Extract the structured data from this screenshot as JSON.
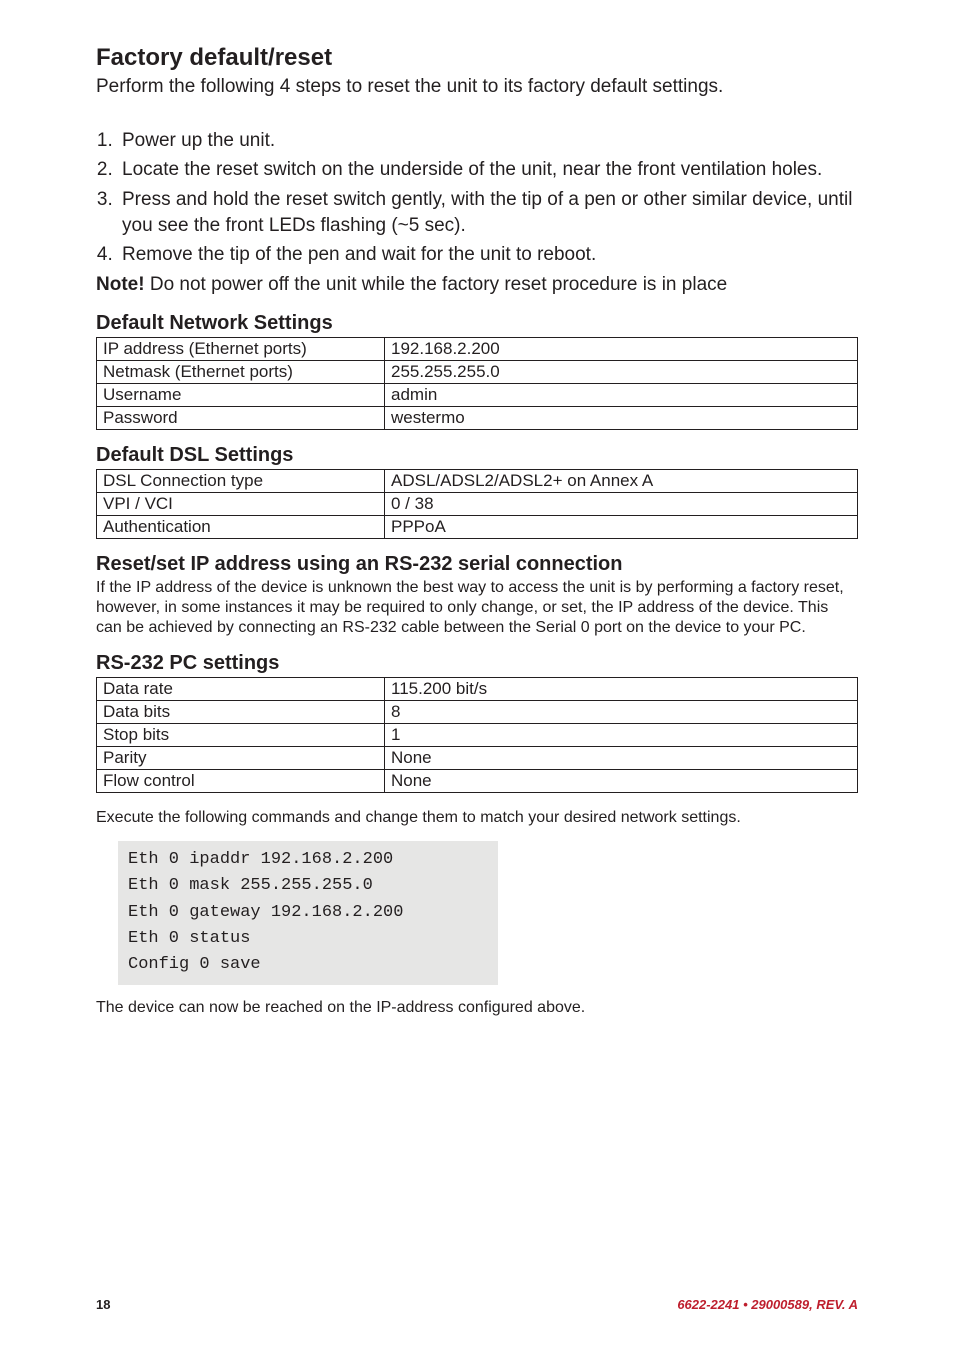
{
  "section_title": "Factory default/reset",
  "intro": "Perform the following 4 steps to reset the unit to its factory default settings.",
  "steps": [
    "Power up the unit.",
    "Locate the reset switch on the underside of the unit, near the front ventilation holes.",
    "Press and hold the reset switch gently, with the tip of a pen or other similar device, until you see the front LEDs flashing (~5 sec).",
    "Remove the tip of the pen and wait for the unit to reboot."
  ],
  "note_label": "Note!",
  "note_text": "  Do not power off the unit while the factory reset procedure is in place",
  "default_network": {
    "heading": "Default Network Settings",
    "rows": [
      {
        "label": "IP address (Ethernet ports)",
        "value": "192.168.2.200"
      },
      {
        "label": "Netmask (Ethernet ports)",
        "value": "255.255.255.0"
      },
      {
        "label": "Username",
        "value": "admin"
      },
      {
        "label": "Password",
        "value": "westermo"
      }
    ]
  },
  "default_dsl": {
    "heading": "Default DSL Settings",
    "rows": [
      {
        "label": "DSL Connection type",
        "value": "ADSL/ADSL2/ADSL2+ on Annex A"
      },
      {
        "label": "VPI / VCI",
        "value": "0 / 38"
      },
      {
        "label": "Authentication",
        "value": "PPPoA"
      }
    ]
  },
  "reset_ip": {
    "heading": "Reset/set IP address using an RS-232 serial connection",
    "body": "If the IP address of the device is unknown the best way to access the unit is by performing a factory reset, however, in some instances it may be required to only change, or set, the IP address of the device. This can be achieved by connecting an RS-232 cable between the Serial 0 port on the device to your PC."
  },
  "rs232": {
    "heading": "RS-232 PC settings",
    "rows": [
      {
        "label": "Data rate",
        "value": "115.200 bit/s"
      },
      {
        "label": "Data bits",
        "value": "8"
      },
      {
        "label": "Stop bits",
        "value": "1"
      },
      {
        "label": "Parity",
        "value": "None"
      },
      {
        "label": "Flow control",
        "value": "None"
      }
    ]
  },
  "exec_text": "Execute the following commands and change them to match your desired network settings.",
  "code": "Eth 0 ipaddr 192.168.2.200\nEth 0 mask 255.255.255.0\nEth 0 gateway 192.168.2.200\nEth 0 status\nConfig 0 save",
  "after_text": "The device can now be reached on the IP-address configured above.",
  "footer": {
    "page": "18",
    "docref": "6622-2241 • 29000589, REV. A"
  }
}
